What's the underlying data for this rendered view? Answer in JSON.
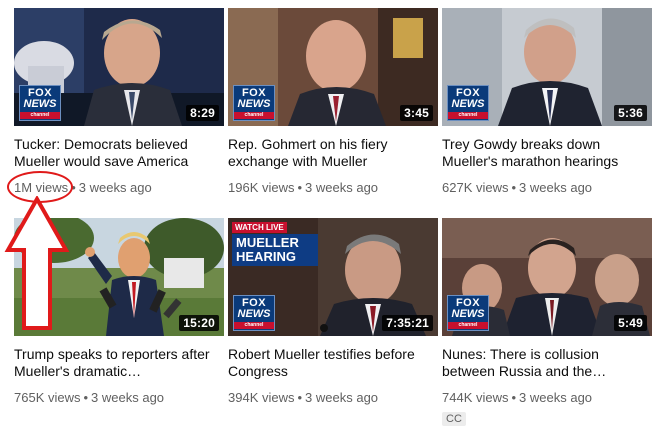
{
  "videos": [
    {
      "title": "Tucker: Democrats believed Mueller would save America",
      "duration": "8:29",
      "views": "1M views",
      "age": "3 weeks ago",
      "logo": "FOX NEWS channel"
    },
    {
      "title": "Rep. Gohmert on his fiery exchange with Mueller",
      "duration": "3:45",
      "views": "196K views",
      "age": "3 weeks ago",
      "logo": "FOX NEWS channel"
    },
    {
      "title": "Trey Gowdy breaks down Mueller's marathon hearings",
      "duration": "5:36",
      "views": "627K views",
      "age": "3 weeks ago",
      "logo": "FOX NEWS channel"
    },
    {
      "title": "Trump speaks to reporters after Mueller's dramatic…",
      "duration": "15:20",
      "views": "765K views",
      "age": "3 weeks ago"
    },
    {
      "title": "Robert Mueller testifies before Congress",
      "duration": "7:35:21",
      "views": "394K views",
      "age": "3 weeks ago",
      "logo": "FOX NEWS channel",
      "watch_live": "WATCH LIVE",
      "banner_line1": "MUELLER",
      "banner_line2": "HEARING"
    },
    {
      "title": "Nunes: There is collusion between Russia and the…",
      "duration": "5:49",
      "views": "744K views",
      "age": "3 weeks ago",
      "logo": "FOX NEWS channel",
      "badge": "CC"
    }
  ],
  "colors": {
    "annotation_red": "#e01a1a",
    "meta_text": "#606060",
    "fox_blue": "#0a3a7a"
  }
}
